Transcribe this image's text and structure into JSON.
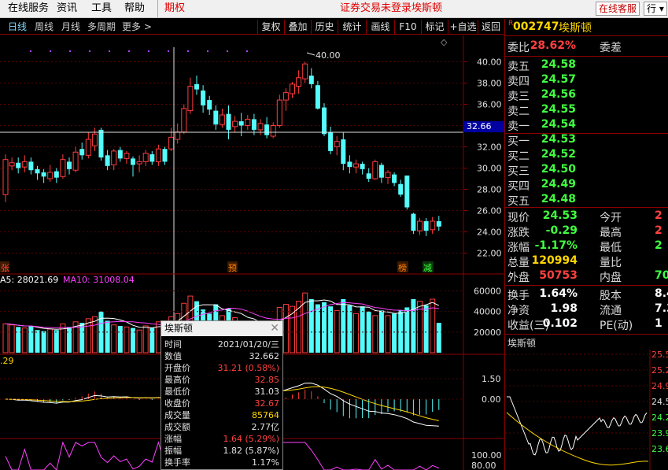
{
  "menubar": {
    "items": [
      "在线服务",
      "资讯",
      "工具",
      "帮助"
    ],
    "options_label": "期权",
    "status": "证券交易未登录",
    "status_stock": "埃斯顿",
    "customer_service": "在线客服",
    "quote_btn": "行"
  },
  "toolbar": {
    "periods": [
      "日线",
      "周线",
      "月线",
      "多周期",
      "更多 >"
    ],
    "buttons": [
      "复权",
      "叠加",
      "历史",
      "统计",
      "画线",
      "F10",
      "标记",
      "+自选",
      "返回"
    ]
  },
  "price_chart": {
    "max_label": "40.00",
    "y_ticks": [
      "40.00",
      "38.00",
      "36.00",
      "34.00",
      "32.00",
      "30.00",
      "28.00",
      "26.00",
      "24.00",
      "22.00"
    ],
    "cursor_price": "32.66",
    "markers": [
      {
        "text": "张",
        "color": "#ff4040"
      },
      {
        "text": "预",
        "color": "#ff8000"
      },
      {
        "text": "榜",
        "color": "#ff8000"
      },
      {
        "text": "减",
        "color": "#40ff40"
      }
    ]
  },
  "volume_chart": {
    "ma_text": "A5: 28021.69",
    "ma10_text": "MA10: 31008.04",
    "y_ticks": [
      "60000",
      "40000",
      "20000"
    ]
  },
  "macd_chart": {
    "label": ".29",
    "y_ticks": [
      "1.50",
      "0.00"
    ]
  },
  "osc_chart": {
    "y_ticks": [
      "100.00",
      "80.00"
    ]
  },
  "chart_data": {
    "type": "candlestick",
    "y_range": [
      21.0,
      41.0
    ],
    "candles": [
      [
        27.5,
        30.8,
        26.8,
        31.3
      ],
      [
        30.2,
        30.5,
        29.8,
        31.0
      ],
      [
        30.5,
        30.0,
        29.5,
        31.0
      ],
      [
        30.1,
        30.6,
        29.6,
        31.2
      ],
      [
        30.6,
        29.8,
        29.4,
        31.0
      ],
      [
        29.9,
        29.5,
        28.9,
        30.2
      ],
      [
        29.6,
        29.2,
        28.6,
        29.9
      ],
      [
        29.0,
        29.6,
        28.7,
        30.3
      ],
      [
        29.7,
        29.1,
        28.6,
        30.0
      ],
      [
        29.2,
        30.8,
        29.0,
        31.3
      ],
      [
        30.6,
        29.9,
        29.4,
        31.0
      ],
      [
        29.8,
        31.5,
        29.6,
        32.0
      ],
      [
        31.8,
        31.2,
        30.8,
        32.4
      ],
      [
        31.2,
        32.7,
        30.9,
        33.4
      ],
      [
        32.1,
        33.2,
        31.6,
        33.8
      ],
      [
        33.6,
        31.0,
        30.7,
        33.8
      ],
      [
        31.2,
        30.2,
        29.8,
        31.7
      ],
      [
        30.3,
        31.6,
        29.8,
        31.8
      ],
      [
        31.7,
        30.9,
        30.6,
        32.0
      ],
      [
        30.9,
        31.4,
        30.4,
        31.6
      ],
      [
        30.9,
        30.3,
        29.2,
        31.1
      ],
      [
        30.4,
        30.6,
        29.6,
        31.2
      ],
      [
        30.6,
        31.4,
        30.2,
        31.7
      ],
      [
        31.3,
        30.6,
        30.3,
        31.6
      ],
      [
        30.6,
        31.8,
        30.2,
        32.2
      ],
      [
        31.8,
        30.6,
        30.3,
        32.0
      ],
      [
        31.8,
        32.9,
        31.6,
        33.8
      ],
      [
        32.7,
        33.4,
        32.3,
        34.2
      ],
      [
        33.4,
        35.6,
        33.2,
        36.0
      ],
      [
        35.4,
        37.7,
        35.1,
        38.5
      ],
      [
        37.9,
        37.4,
        36.9,
        38.7
      ],
      [
        37.3,
        35.9,
        35.2,
        37.8
      ],
      [
        36.4,
        35.5,
        35.0,
        36.8
      ],
      [
        35.4,
        34.1,
        33.6,
        35.9
      ],
      [
        34.1,
        35.0,
        33.8,
        35.6
      ],
      [
        35.1,
        33.6,
        32.7,
        35.9
      ],
      [
        33.9,
        34.4,
        33.4,
        34.9
      ],
      [
        34.4,
        34.0,
        33.0,
        35.2
      ],
      [
        34.0,
        34.6,
        33.6,
        35.0
      ],
      [
        34.6,
        33.6,
        33.1,
        35.1
      ],
      [
        33.6,
        34.2,
        33.1,
        34.6
      ],
      [
        34.1,
        33.1,
        32.8,
        34.8
      ],
      [
        33.0,
        34.0,
        32.8,
        34.3
      ],
      [
        34.0,
        36.4,
        33.8,
        36.9
      ],
      [
        36.4,
        37.1,
        35.4,
        37.5
      ],
      [
        37.0,
        37.9,
        36.6,
        38.1
      ],
      [
        37.7,
        38.5,
        37.0,
        39.2
      ],
      [
        38.4,
        39.8,
        38.0,
        40.0
      ],
      [
        38.7,
        37.9,
        37.5,
        39.4
      ],
      [
        37.8,
        35.6,
        35.5,
        38.2
      ],
      [
        35.7,
        33.2,
        33.0,
        36.1
      ],
      [
        33.4,
        31.6,
        31.3,
        33.9
      ],
      [
        32.0,
        32.5,
        31.2,
        33.0
      ],
      [
        32.7,
        30.4,
        29.8,
        33.4
      ],
      [
        30.6,
        30.1,
        29.5,
        31.2
      ],
      [
        30.1,
        30.4,
        29.5,
        30.8
      ],
      [
        30.4,
        29.9,
        29.4,
        30.6
      ],
      [
        29.5,
        29.0,
        28.7,
        30.0
      ],
      [
        29.0,
        30.6,
        28.9,
        30.8
      ],
      [
        30.3,
        29.1,
        28.6,
        30.5
      ],
      [
        29.1,
        29.6,
        28.5,
        29.8
      ],
      [
        29.4,
        28.6,
        28.3,
        29.6
      ],
      [
        28.5,
        27.5,
        27.3,
        28.9
      ],
      [
        29.3,
        26.3,
        26.1,
        29.3
      ],
      [
        25.7,
        24.1,
        23.8,
        25.8
      ],
      [
        24.1,
        25.0,
        23.7,
        25.3
      ],
      [
        25.0,
        24.1,
        23.6,
        25.3
      ],
      [
        24.2,
        25.0,
        23.8,
        25.4
      ],
      [
        25.0,
        24.5,
        24.1,
        25.5
      ]
    ],
    "volumes": [
      28,
      27,
      25,
      24,
      26,
      22,
      21,
      23,
      22,
      28,
      25,
      30,
      29,
      33,
      35,
      40,
      31,
      27,
      26,
      25,
      24,
      22,
      26,
      24,
      30,
      26,
      35,
      38,
      48,
      55,
      50,
      42,
      38,
      47,
      36,
      43,
      34,
      30,
      29,
      28,
      26,
      24,
      30,
      44,
      47,
      45,
      50,
      58,
      52,
      47,
      49,
      45,
      41,
      52,
      46,
      38,
      45,
      40,
      36,
      41,
      36,
      38,
      41,
      44,
      52,
      50,
      46,
      52,
      29
    ]
  },
  "quote_panel": {
    "r_mark": "R",
    "code": "002747",
    "name": "埃斯顿",
    "weibi_label": "委比",
    "weibi_value": "28.62%",
    "weicha_label": "委差",
    "sell": [
      {
        "label": "卖五",
        "price": "24.58"
      },
      {
        "label": "卖四",
        "price": "24.57"
      },
      {
        "label": "卖三",
        "price": "24.56"
      },
      {
        "label": "卖二",
        "price": "24.55"
      },
      {
        "label": "卖一",
        "price": "24.54"
      }
    ],
    "buy": [
      {
        "label": "买一",
        "price": "24.53"
      },
      {
        "label": "买二",
        "price": "24.52"
      },
      {
        "label": "买三",
        "price": "24.50"
      },
      {
        "label": "买四",
        "price": "24.49"
      },
      {
        "label": "买五",
        "price": "24.48"
      }
    ],
    "stats": [
      {
        "l1": "现价",
        "v1": "24.53",
        "c1": "#40ff40",
        "l2": "今开",
        "v2": "2",
        "c2": "#ff4040"
      },
      {
        "l1": "涨跌",
        "v1": "-0.29",
        "c1": "#40ff40",
        "l2": "最高",
        "v2": "2",
        "c2": "#ff4040"
      },
      {
        "l1": "涨幅",
        "v1": "-1.17%",
        "c1": "#40ff40",
        "l2": "最低",
        "v2": "2",
        "c2": "#40ff40"
      },
      {
        "l1": "总量",
        "v1": "120994",
        "c1": "#ffd700",
        "l2": "量比",
        "v2": "",
        "c2": "#ffd700"
      },
      {
        "l1": "外盘",
        "v1": "50753",
        "c1": "#ff4040",
        "l2": "内盘",
        "v2": "70",
        "c2": "#40ff40"
      }
    ],
    "stats2": [
      {
        "l1": "换手",
        "v1": "1.64%",
        "l2": "股本",
        "v2": "8.4"
      },
      {
        "l1": "净资",
        "v1": "1.98",
        "l2": "流通",
        "v2": "7.3"
      },
      {
        "l1": "收益(三)",
        "v1": "0.102",
        "l2": "PE(动)",
        "v2": "1"
      }
    ],
    "mini_title": "埃斯顿",
    "mini_ticks": [
      "25.5",
      "25.2",
      "24.9",
      "24.5",
      "24.2",
      "23.9",
      "23.6"
    ]
  },
  "tooltip": {
    "title": "埃斯顿",
    "rows": [
      {
        "label": "时间",
        "value": "2021/01/20/三",
        "color": "#e0e0e0"
      },
      {
        "label": "数值",
        "value": "32.662",
        "color": "#e0e0e0"
      },
      {
        "label": "开盘价",
        "value": "31.21 (0.58%)",
        "color": "#ff4040"
      },
      {
        "label": "最高价",
        "value": "32.85",
        "color": "#ff4040"
      },
      {
        "label": "最低价",
        "value": "31.03",
        "color": "#e0e0e0"
      },
      {
        "label": "收盘价",
        "value": "32.67",
        "color": "#ff4040"
      },
      {
        "label": "成交量",
        "value": "85764",
        "color": "#ffd700"
      },
      {
        "label": "成交额",
        "value": "2.77亿",
        "color": "#e0e0e0"
      },
      {
        "label": "涨幅",
        "value": "1.64 (5.29%)",
        "color": "#ff4040"
      },
      {
        "label": "振幅",
        "value": "1.82 (5.87%)",
        "color": "#e0e0e0"
      },
      {
        "label": "换手率",
        "value": "1.17%",
        "color": "#e0e0e0"
      }
    ]
  }
}
